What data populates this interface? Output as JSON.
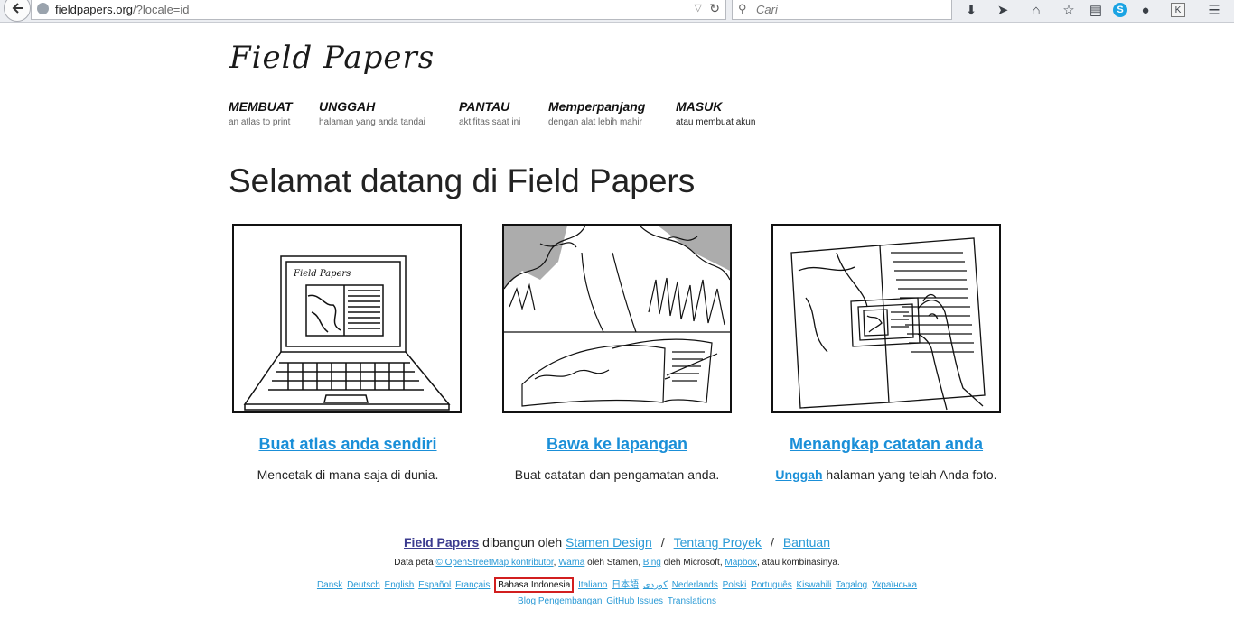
{
  "browser": {
    "url_host": "fieldpapers.org",
    "url_rest": "/?locale=id",
    "search_placeholder": "Cari",
    "skype_letter": "S",
    "k_letter": "K"
  },
  "site": {
    "logo": "Field Papers",
    "nav": [
      {
        "title": "MEMBUAT",
        "sub": "an atlas to print"
      },
      {
        "title": "UNGGAH",
        "sub": "halaman yang anda tandai"
      },
      {
        "title": "PANTAU",
        "sub": "aktifitas saat ini"
      },
      {
        "title": "Memperpanjang",
        "sub": "dengan alat lebih mahir"
      },
      {
        "title": "MASUK",
        "sub": "atau membuat akun"
      }
    ],
    "page_title": "Selamat datang di Field Papers",
    "illus_logo_text": "Field Papers",
    "cards": [
      {
        "link": "Buat atlas anda sendiri",
        "desc": "Mencetak di mana saja di dunia."
      },
      {
        "link": "Bawa ke lapangan",
        "desc": "Buat catatan dan pengamatan anda."
      },
      {
        "link": "Menangkap catatan anda",
        "desc_link": "Unggah",
        "desc": " halaman yang telah Anda foto."
      }
    ]
  },
  "footer": {
    "brand": "Field Papers",
    "built_by": " dibangun oleh ",
    "stamen": "Stamen Design",
    "sep": "/",
    "about": "Tentang Proyek",
    "help": "Bantuan",
    "data_prefix": "Data peta ",
    "osm": "© OpenStreetMap kontributor",
    "comma": ", ",
    "warna": "Warna",
    "by_stamen": " oleh Stamen, ",
    "bing": "Bing",
    "by_ms": " oleh Microsoft, ",
    "mapbox": "Mapbox",
    "or_combo": ", atau kombinasinya.",
    "languages": [
      "Dansk",
      "Deutsch",
      "English",
      "Español",
      "Français",
      "Bahasa Indonesia",
      "Italiano",
      "日本語",
      "کوردی",
      "Nederlands",
      "Polski",
      "Português",
      "Kiswahili",
      "Tagalog",
      "Українська"
    ],
    "current_language_index": 5,
    "bottom_links": [
      "Blog Pengembangan",
      "GitHub Issues",
      "Translations"
    ]
  }
}
